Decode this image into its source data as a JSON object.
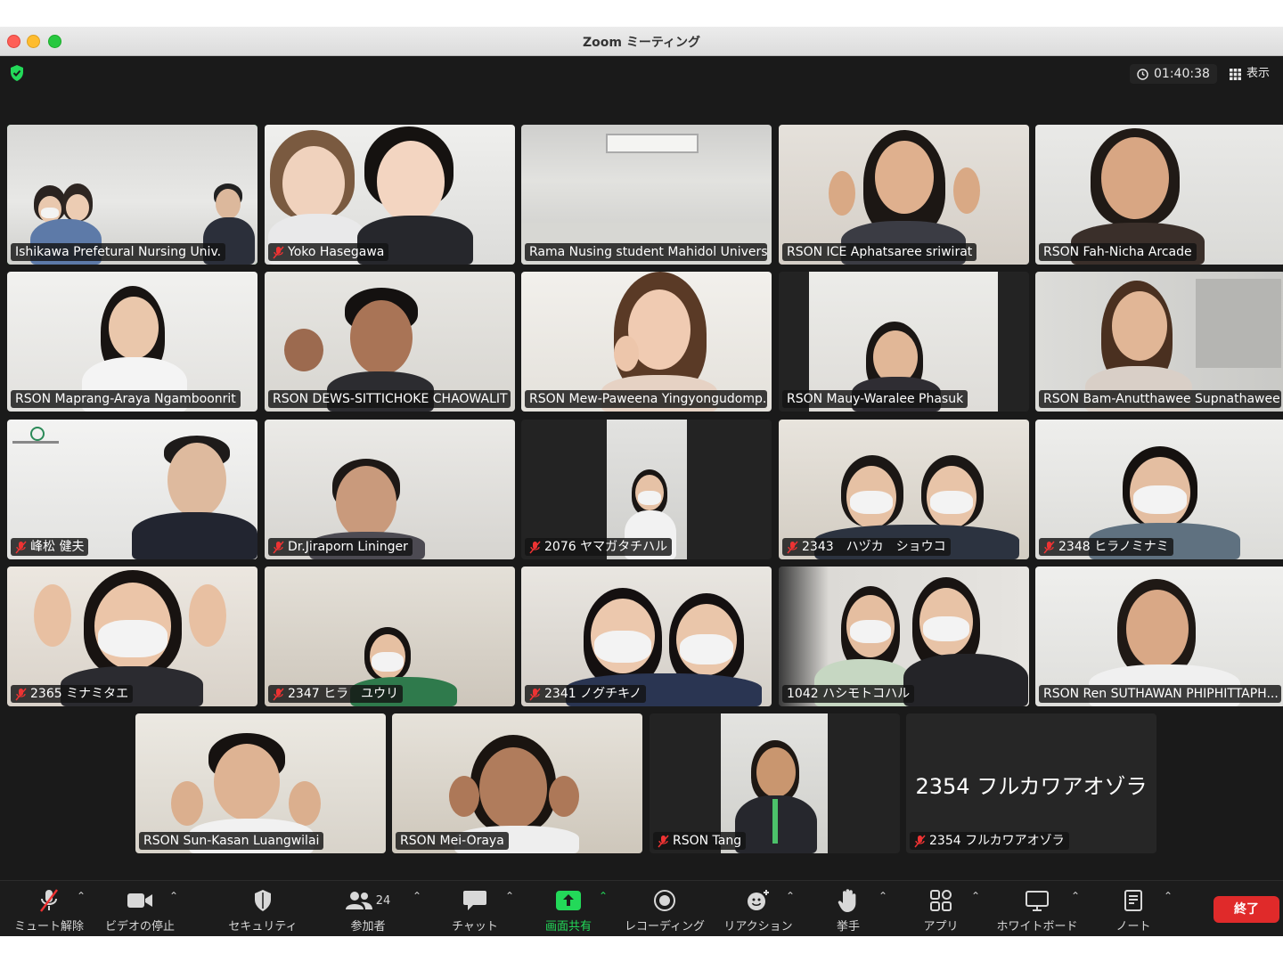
{
  "window": {
    "title": "Zoom ミーティング"
  },
  "topbar": {
    "timer": "01:40:38",
    "view_label": "表示"
  },
  "participants": [
    {
      "name": "Ishikawa Prefetural Nursing Univ.",
      "muted": false
    },
    {
      "name": "Yoko Hasegawa",
      "muted": true
    },
    {
      "name": "Rama Nusing student Mahidol Universi...",
      "muted": false
    },
    {
      "name": "RSON ICE Aphatsaree sriwirat",
      "muted": false
    },
    {
      "name": "RSON Fah-Nicha Arcade",
      "muted": false
    },
    {
      "name": "RSON Maprang-Araya Ngamboonrit",
      "muted": false
    },
    {
      "name": "RSON DEWS-SITTICHOKE CHAOWALIT",
      "muted": false
    },
    {
      "name": "RSON Mew-Paweena Yingyongudomp...",
      "muted": false
    },
    {
      "name": "RSON Mauy-Waralee Phasuk",
      "muted": false
    },
    {
      "name": "RSON Bam-Anutthawee Supnathawee",
      "muted": false
    },
    {
      "name": "峰松 健夫",
      "muted": true
    },
    {
      "name": "Dr.Jiraporn Lininger",
      "muted": true
    },
    {
      "name": "2076 ヤマガタチハル",
      "muted": true
    },
    {
      "name": "2343　ハヅカ　ショウコ",
      "muted": true
    },
    {
      "name": "2348 ヒラノミナミ",
      "muted": true
    },
    {
      "name": "2365 ミナミタエ",
      "muted": true
    },
    {
      "name": "2347 ヒラ　ユウリ",
      "muted": true
    },
    {
      "name": "2341 ノグチキノ",
      "muted": true
    },
    {
      "name": "1042 ハシモトコハル",
      "muted": false
    },
    {
      "name": "RSON Ren SUTHAWAN PHIPHITTAPH...",
      "muted": false
    },
    {
      "name": "RSON Sun-Kasan Luangwilai",
      "muted": false
    },
    {
      "name": "RSON Mei-Oraya",
      "muted": false
    },
    {
      "name": "RSON Tang",
      "muted": true
    },
    {
      "name": "2354 フルカワアオゾラ",
      "muted": true,
      "video_off": true
    }
  ],
  "toolbar": {
    "unmute": "ミュート解除",
    "stop_video": "ビデオの停止",
    "security": "セキュリティ",
    "participants": "参加者",
    "participants_count": "24",
    "chat": "チャット",
    "share_screen": "画面共有",
    "recording": "レコーディング",
    "reactions": "リアクション",
    "raise_hand": "挙手",
    "apps": "アプリ",
    "whiteboard": "ホワイトボード",
    "notes": "ノート",
    "end": "終了"
  },
  "colors": {
    "accent_green": "#23d959",
    "end_red": "#e02a2a",
    "background": "#1a1a1a"
  }
}
